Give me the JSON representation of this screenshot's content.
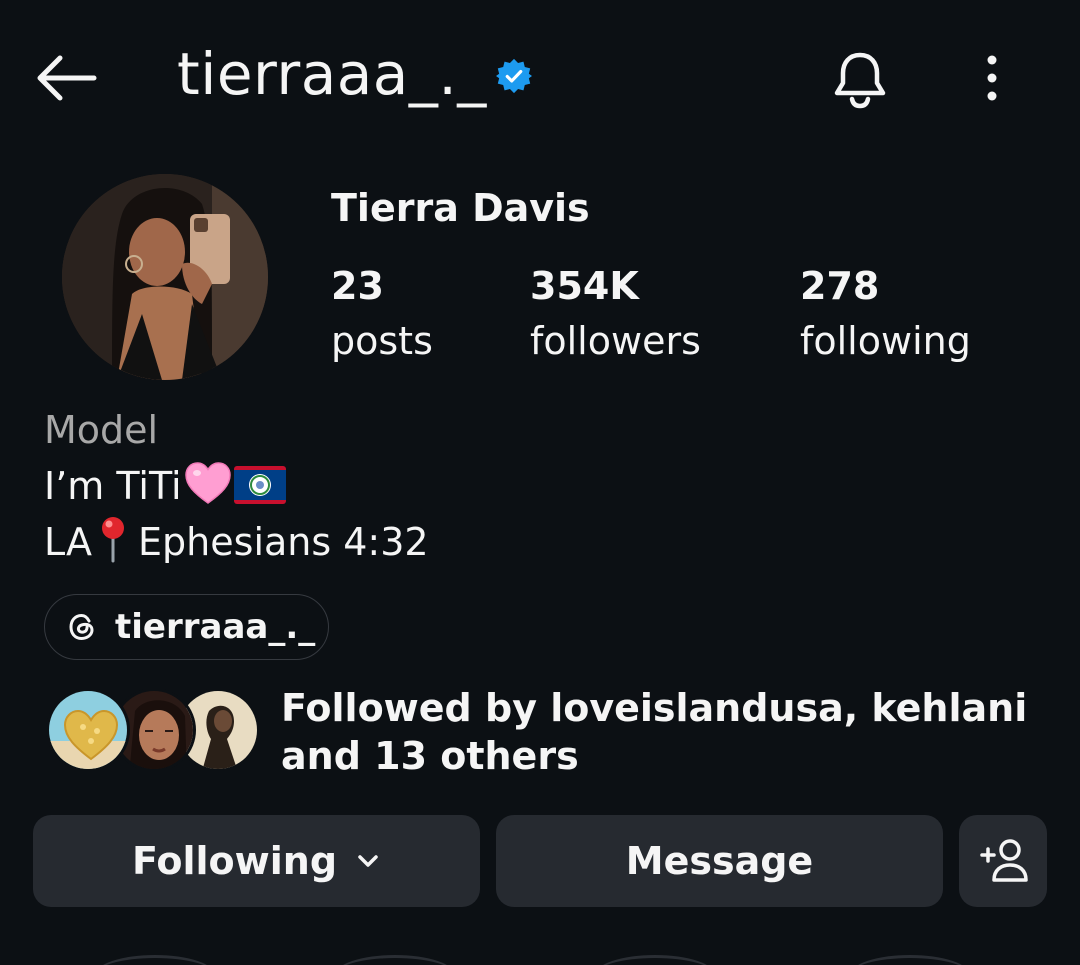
{
  "header": {
    "username": "tierraaa_._",
    "icons": {
      "back": "arrow-left-icon",
      "verified": "verified-badge-icon",
      "notifications": "bell-icon",
      "more": "more-vertical-icon"
    }
  },
  "profile": {
    "display_name": "Tierra Davis",
    "stats": [
      {
        "value": "23",
        "label": "posts"
      },
      {
        "value": "354K",
        "label": "followers"
      },
      {
        "value": "278",
        "label": "following"
      }
    ]
  },
  "bio": {
    "category": "Model",
    "line1_text": "I’m TiTi",
    "line1_emojis": [
      "pink-heart",
      "belize-flag"
    ],
    "line2_prefix": "LA",
    "line2_emoji": "round-pushpin",
    "line2_suffix": "Ephesians 4:32"
  },
  "threads_link": {
    "label": "tierraaa_._",
    "icon": "threads-icon"
  },
  "followed_by": {
    "text": "Followed by loveislandusa, kehlani and 13 others"
  },
  "actions": {
    "following_label": "Following",
    "message_label": "Message",
    "add_user_icon": "add-person-icon"
  },
  "colors": {
    "background": "#0c1014",
    "button": "#262a30",
    "verified_blue": "#1d9bf0",
    "secondary_text": "#a8a8a8"
  }
}
